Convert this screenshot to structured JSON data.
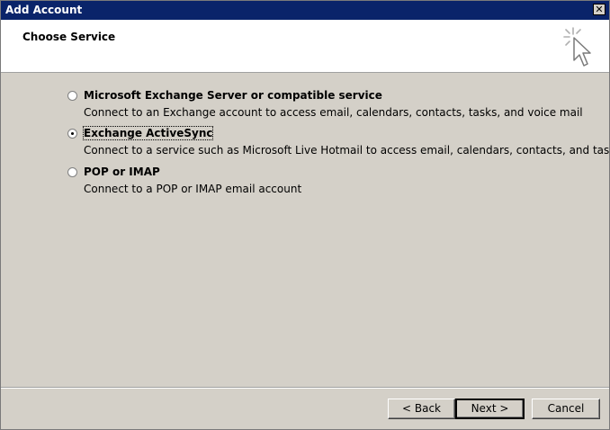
{
  "window": {
    "title": "Add Account",
    "close_glyph": "✕"
  },
  "header": {
    "title": "Choose Service",
    "icon": "wizard-cursor-icon"
  },
  "options": [
    {
      "label": "Microsoft Exchange Server or compatible service",
      "description": "Connect to an Exchange account to access email, calendars, contacts, tasks, and voice mail",
      "selected": false
    },
    {
      "label": "Exchange ActiveSync",
      "description": "Connect to a service such as Microsoft Live Hotmail to access email, calendars, contacts, and tasks",
      "selected": true
    },
    {
      "label": "POP or IMAP",
      "description": "Connect to a POP or IMAP email account",
      "selected": false
    }
  ],
  "buttons": {
    "back": "< Back",
    "next": "Next >",
    "cancel": "Cancel"
  },
  "colors": {
    "titlebar": "#0a246a",
    "dialog_bg": "#d4d0c8",
    "header_bg": "#ffffff"
  }
}
